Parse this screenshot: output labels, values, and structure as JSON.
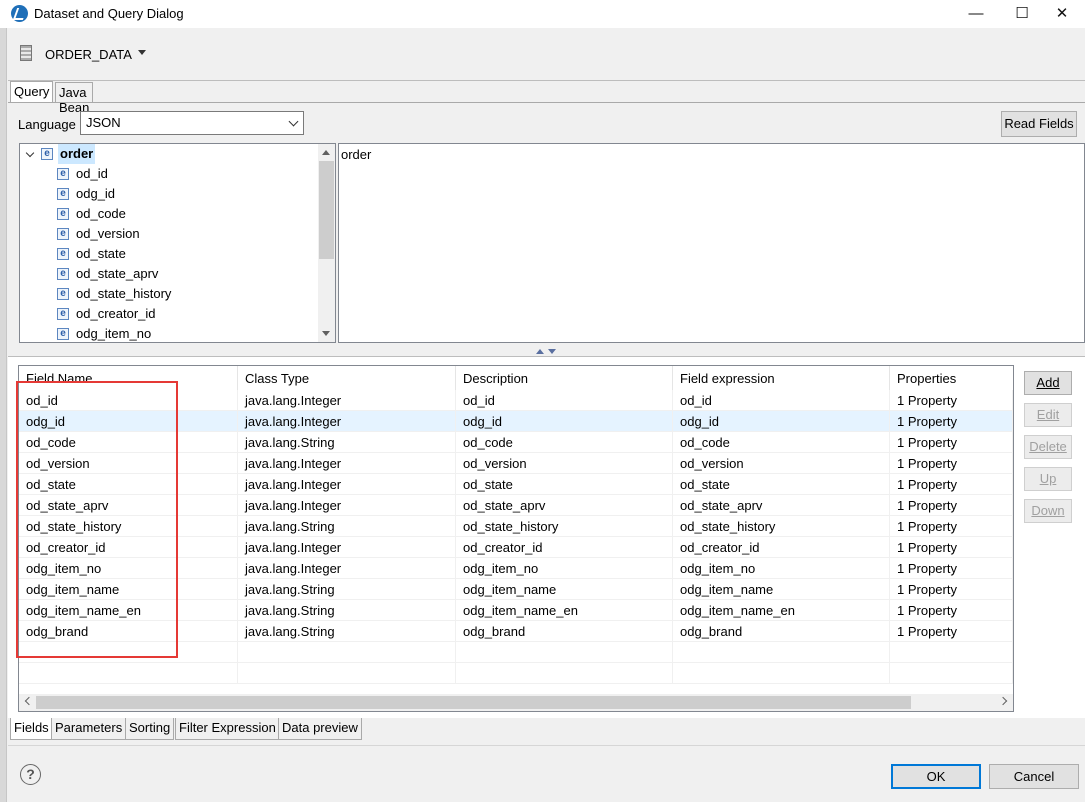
{
  "window": {
    "title": "Dataset and Query Dialog",
    "controls": {
      "minimize": "—",
      "maximize": "☐",
      "close": "✕"
    }
  },
  "dataset": {
    "name": "ORDER_DATA"
  },
  "query": {
    "tabs": [
      {
        "label": "Query"
      },
      {
        "label": "Java Bean"
      }
    ],
    "language_label": "Language",
    "language_value": "JSON",
    "read_fields_label": "Read Fields",
    "tree": {
      "root": "order",
      "children": [
        "od_id",
        "odg_id",
        "od_code",
        "od_version",
        "od_state",
        "od_state_aprv",
        "od_state_history",
        "od_creator_id",
        "odg_item_no"
      ]
    },
    "expression_text": "order"
  },
  "fields": {
    "columns": [
      "Field Name",
      "Class Type",
      "Description",
      "Field expression",
      "Properties"
    ],
    "rows": [
      [
        "od_id",
        "java.lang.Integer",
        "od_id",
        "od_id",
        "1 Property"
      ],
      [
        "odg_id",
        "java.lang.Integer",
        "odg_id",
        "odg_id",
        "1 Property"
      ],
      [
        "od_code",
        "java.lang.String",
        "od_code",
        "od_code",
        "1 Property"
      ],
      [
        "od_version",
        "java.lang.Integer",
        "od_version",
        "od_version",
        "1 Property"
      ],
      [
        "od_state",
        "java.lang.Integer",
        "od_state",
        "od_state",
        "1 Property"
      ],
      [
        "od_state_aprv",
        "java.lang.Integer",
        "od_state_aprv",
        "od_state_aprv",
        "1 Property"
      ],
      [
        "od_state_history",
        "java.lang.String",
        "od_state_history",
        "od_state_history",
        "1 Property"
      ],
      [
        "od_creator_id",
        "java.lang.Integer",
        "od_creator_id",
        "od_creator_id",
        "1 Property"
      ],
      [
        "odg_item_no",
        "java.lang.Integer",
        "odg_item_no",
        "odg_item_no",
        "1 Property"
      ],
      [
        "odg_item_name",
        "java.lang.String",
        "odg_item_name",
        "odg_item_name",
        "1 Property"
      ],
      [
        "odg_item_name_en",
        "java.lang.String",
        "odg_item_name_en",
        "odg_item_name_en",
        "1 Property"
      ],
      [
        "odg_brand",
        "java.lang.String",
        "odg_brand",
        "odg_brand",
        "1 Property"
      ]
    ],
    "buttons": {
      "add": "Add",
      "edit": "Edit",
      "delete": "Delete",
      "up": "Up",
      "down": "Down"
    }
  },
  "bottom_tabs": [
    {
      "label": "Fields"
    },
    {
      "label": "Parameters"
    },
    {
      "label": "Sorting"
    },
    {
      "label": "Filter Expression"
    },
    {
      "label": "Data preview"
    }
  ],
  "footer": {
    "help": "?",
    "ok_label": "OK",
    "cancel_label": "Cancel"
  },
  "colors": {
    "highlight_box": "#e53935",
    "selection": "#e5f3ff",
    "tree_selection": "#cce8ff"
  },
  "icons": {
    "dataset": "database-icon",
    "tree_item": "element-icon",
    "help": "help-icon"
  }
}
